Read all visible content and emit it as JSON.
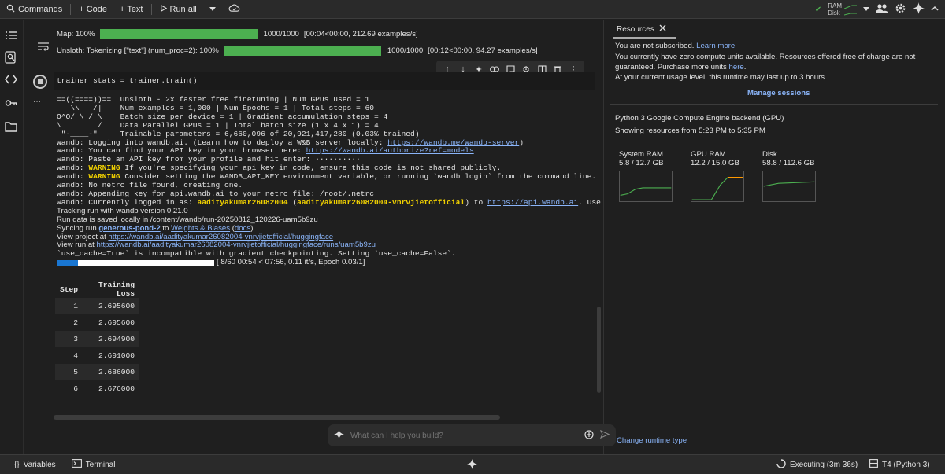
{
  "topbar": {
    "commands": "Commands",
    "code": "+ Code",
    "text": "+ Text",
    "run_all": "Run all",
    "ram_label": "RAM",
    "disk_label": "Disk"
  },
  "progress": [
    {
      "label": "Map: 100%",
      "fraction": 1.0,
      "count": "1000/1000",
      "info": "[00:04<00:00,  212.69  examples/s]"
    },
    {
      "label": "Unsloth: Tokenizing [\"text\"] (num_proc=2): 100%",
      "fraction": 1.0,
      "count": "1000/1000",
      "info": "[00:12<00:00,  94.27  examples/s]"
    }
  ],
  "code": "trainer_stats = trainer.train()",
  "output": {
    "banner": [
      "==((====))==  Unsloth - 2x faster free finetuning | Num GPUs used = 1",
      "   \\\\   /|    Num examples = 1,000 | Num Epochs = 1 | Total steps = 60",
      "O^O/ \\_/ \\    Batch size per device = 1 | Gradient accumulation steps = 4",
      "\\        /    Data Parallel GPUs = 1 | Total batch size (1 x 4 x 1) = 4",
      " \"-____-\"     Trainable parameters = 6,660,096 of 20,921,417,280 (0.03% trained)"
    ],
    "wandb_prefix": "wandb:",
    "w1_text": " Logging into wandb.ai. (Learn how to deploy a W&B server locally: ",
    "w1_link": "https://wandb.me/wandb-server",
    "w1_end": ")",
    "w2_text": " You can find your API key in your browser here: ",
    "w2_link": "https://wandb.ai/authorize?ref=models",
    "w3_text": " Paste an API key from your profile and hit enter: ··········",
    "warning": "WARNING",
    "w4_text": " If you're specifying your api key in code, ensure this code is not shared publicly.",
    "w5_text": " Consider setting the WANDB_API_KEY environment variable, or running `wandb login` from the command line.",
    "w6_text": " No netrc file found, creating one.",
    "w7_text": " Appending key for api.wandb.ai to your netrc file: /root/.netrc",
    "w8_text": " Currently logged in as: ",
    "w8_user": "aadityakumar26082004",
    "w8_mid": " (",
    "w8_org": "aadityakumar26082004-vnrvjietofficial",
    "w8_to": ") to ",
    "w8_link": "https://api.wandb.ai",
    "w8_end": ". Use `wandb login",
    "tracking": "Tracking run with wandb version 0.21.0",
    "saved": "Run data is saved locally in /content/wandb/run-20250812_120226-uam5b9zu",
    "syncing_pre": "Syncing run ",
    "syncing_run": "generous-pond-2",
    "syncing_to": " to ",
    "syncing_wb": "Weights & Biases",
    "syncing_docs_pre": " (",
    "syncing_docs": "docs",
    "syncing_docs_end": ")",
    "project_pre": "View project at ",
    "project_link": "https://wandb.ai/aadityakumar26082004-vnrvjietofficial/huggingface",
    "run_pre": "View run at ",
    "run_link": "https://wandb.ai/aadityakumar26082004-vnrvjietofficial/huggingface/runs/uam5b9zu",
    "use_cache": "`use_cache=True` is incompatible with gradient checkpointing. Setting `use_cache=False`.",
    "train_progress_fraction": 0.133,
    "train_progress_text": "[ 8/60 00:54 < 07:56, 0.11 it/s, Epoch 0.03/1]"
  },
  "table": {
    "headers": [
      "Step",
      "Training Loss"
    ],
    "rows": [
      [
        "1",
        "2.695600"
      ],
      [
        "2",
        "2.695600"
      ],
      [
        "3",
        "2.694900"
      ],
      [
        "4",
        "2.691000"
      ],
      [
        "5",
        "2.686000"
      ],
      [
        "6",
        "2.676000"
      ]
    ]
  },
  "resources": {
    "tab": "Resources",
    "sub1_text": "You are not subscribed. ",
    "sub1_link": "Learn more",
    "sub2": "You currently have zero compute units available. Resources offered free of charge are not guaranteed. Purchase more units ",
    "sub2_link": "here",
    "sub2_end": ".",
    "sub3": "At your current usage level, this runtime may last up to 3 hours.",
    "manage": "Manage sessions",
    "backend": "Python 3 Google Compute Engine backend (GPU)",
    "showing": "Showing resources from 5:23 PM to 5:35 PM",
    "system_ram_label": "System RAM",
    "system_ram_value": "5.8 / 12.7 GB",
    "gpu_ram_label": "GPU RAM",
    "gpu_ram_value": "12.2 / 15.0 GB",
    "disk_label": "Disk",
    "disk_value": "58.8 / 112.6 GB",
    "change_runtime": "Change runtime type"
  },
  "ai_input": {
    "placeholder": "What can I help you build?"
  },
  "bottombar": {
    "variables": "Variables",
    "terminal": "Terminal",
    "executing": "Executing (3m 36s)",
    "runtime": "T4 (Python 3)"
  },
  "colors": {
    "accent": "#8ab4f8",
    "progress": "#4caf50",
    "warning": "#f0d000"
  }
}
